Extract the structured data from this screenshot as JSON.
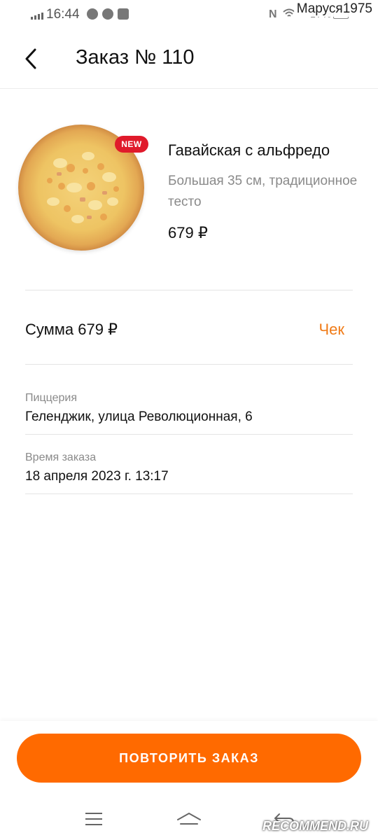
{
  "status_bar": {
    "time": "16:44",
    "right_text": "17%",
    "watermark_user": "Маруся1975",
    "icons": [
      "signal-icon",
      "whatsapp-icon",
      "chrome-icon",
      "youtube-icon",
      "nfc-icon",
      "wifi-icon",
      "battery-icon"
    ]
  },
  "header": {
    "title": "Заказ № 110",
    "back_icon": "chevron-left-icon"
  },
  "product": {
    "badge": "NEW",
    "name": "Гавайская с альфредо",
    "description": "Большая 35 см, традиционное тесто",
    "price": "679 ₽"
  },
  "summary": {
    "sum_text": "Сумма 679 ₽",
    "receipt_link": "Чек"
  },
  "details": [
    {
      "label": "Пиццерия",
      "value": "Геленджик, улица Революционная, 6"
    },
    {
      "label": "Время заказа",
      "value": "18 апреля 2023 г. 13:17"
    }
  ],
  "actions": {
    "repeat_label": "ПОВТОРИТЬ ЗАКАЗ"
  },
  "navbar": {
    "icons": [
      "menu-icon",
      "home-icon",
      "back-icon"
    ]
  },
  "watermark": {
    "site": "RECOMMEND.RU"
  },
  "colors": {
    "accent": "#ff6a00",
    "link": "#f07b17",
    "badge": "#e01a2b"
  }
}
